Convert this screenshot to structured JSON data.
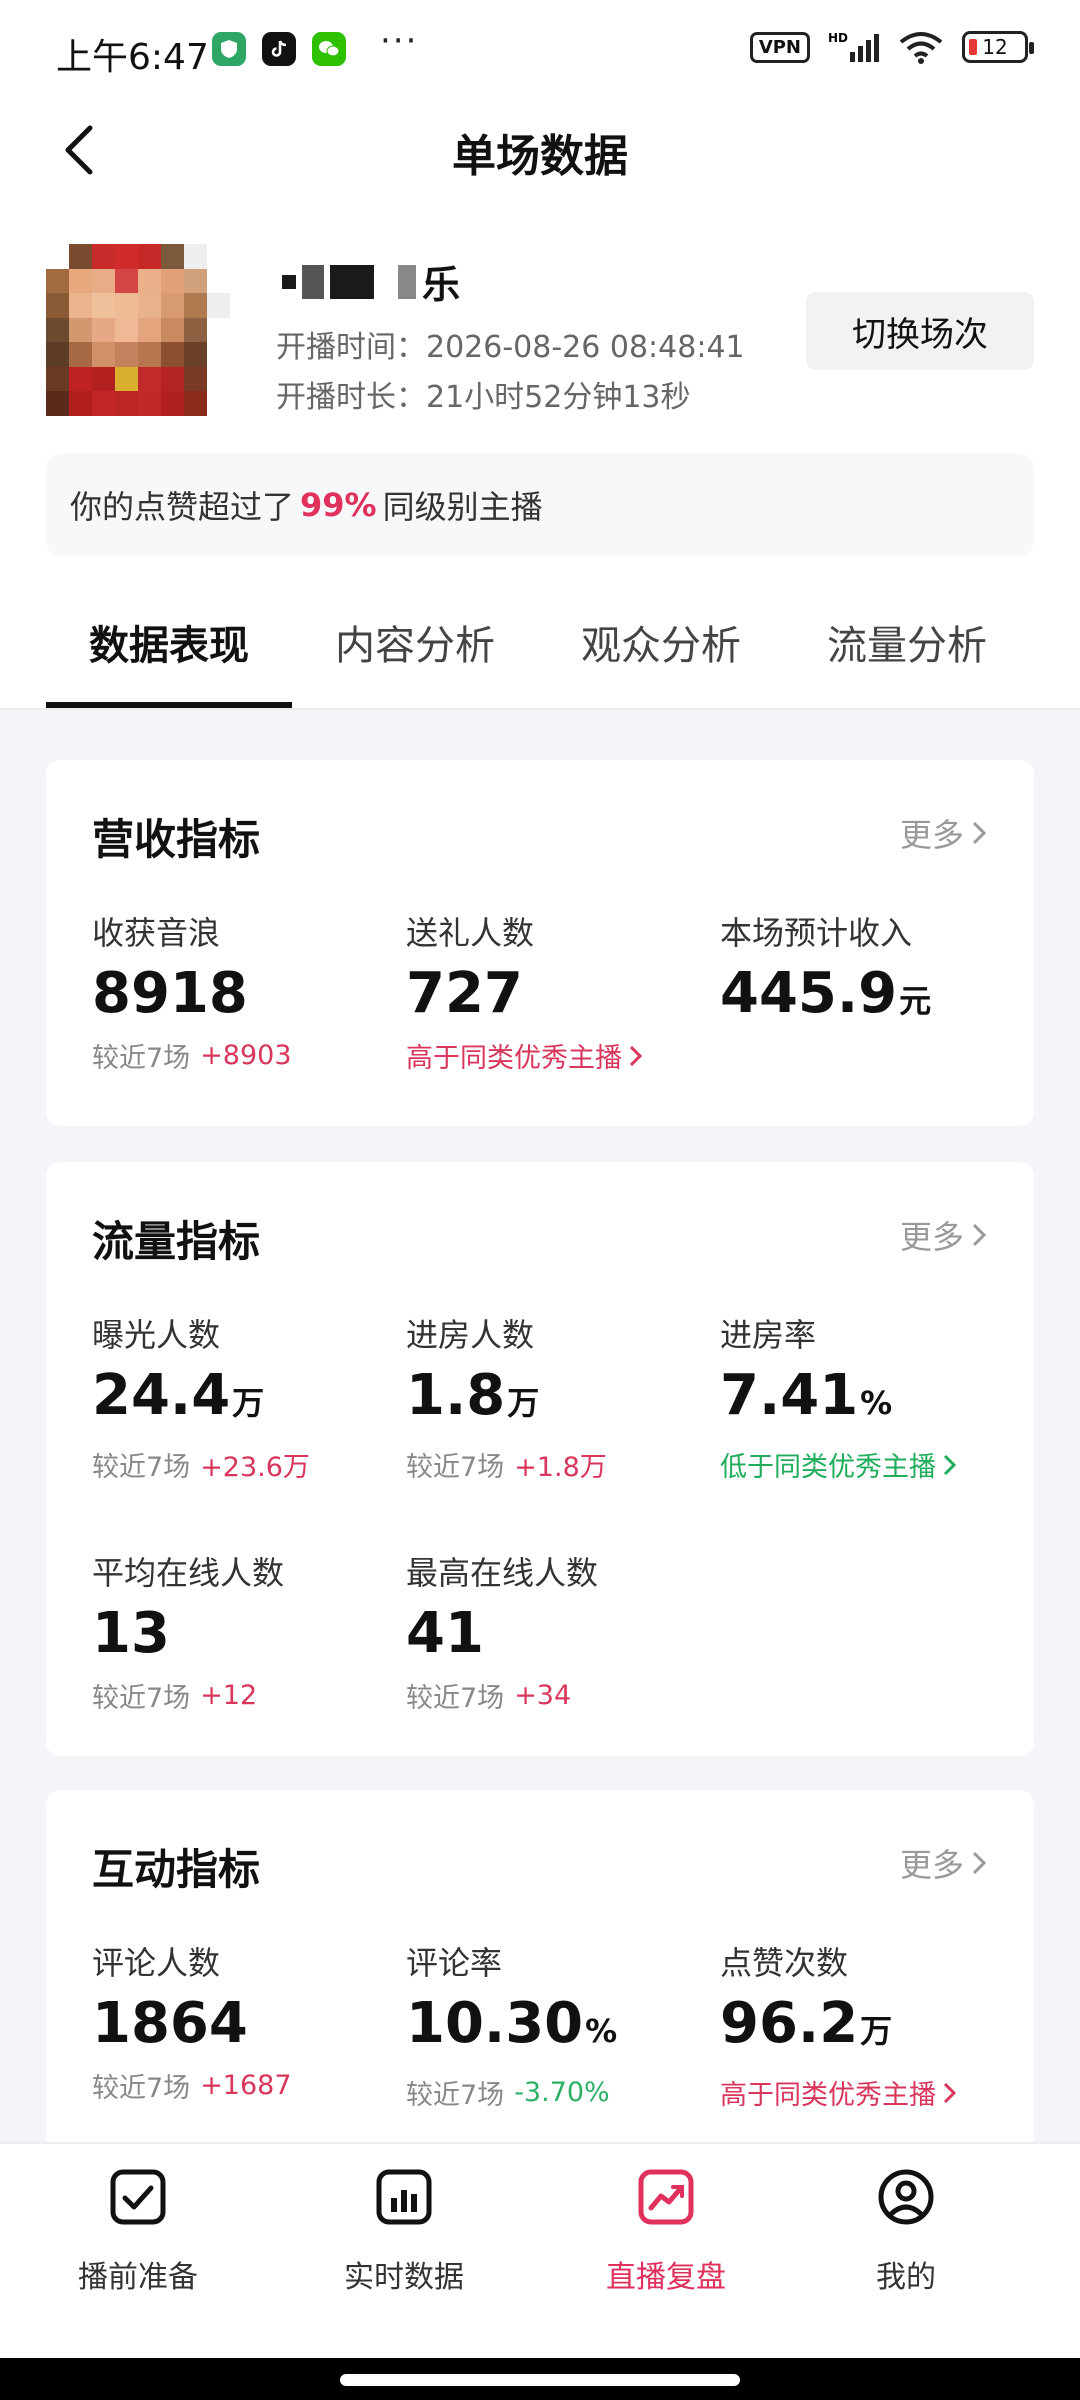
{
  "status_bar": {
    "time": "上午6:47",
    "vpn": "VPN",
    "battery": "12",
    "more_dots": "···"
  },
  "nav": {
    "title": "单场数据"
  },
  "profile": {
    "name_suffix": "乐",
    "start_time_label": "开播时间：",
    "start_time": "2026-08-26 08:48:41",
    "duration_label": "开播时长：",
    "duration": "21小时52分钟13秒",
    "switch_label": "切换场次"
  },
  "like_banner": {
    "prefix": "你的点赞超过了",
    "percent": "99%",
    "suffix": "同级别主播"
  },
  "tabs": [
    "数据表现",
    "内容分析",
    "观众分析",
    "流量分析"
  ],
  "revenue": {
    "title": "营收指标",
    "more": "更多",
    "metrics": [
      {
        "label": "收获音浪",
        "value": "8918",
        "unit": "",
        "sub_label": "较近7场",
        "delta": "+8903"
      },
      {
        "label": "送礼人数",
        "value": "727",
        "unit": "",
        "link": "高于同类优秀主播"
      },
      {
        "label": "本场预计收入",
        "value": "445.9",
        "unit": "元"
      }
    ]
  },
  "traffic": {
    "title": "流量指标",
    "more": "更多",
    "metrics": [
      {
        "label": "曝光人数",
        "value": "24.4",
        "unit": "万",
        "sub_label": "较近7场",
        "delta": "+23.6万"
      },
      {
        "label": "进房人数",
        "value": "1.8",
        "unit": "万",
        "sub_label": "较近7场",
        "delta": "+1.8万"
      },
      {
        "label": "进房率",
        "value": "7.41",
        "unit": "%",
        "link": "低于同类优秀主播"
      },
      {
        "label": "平均在线人数",
        "value": "13",
        "unit": "",
        "sub_label": "较近7场",
        "delta": "+12"
      },
      {
        "label": "最高在线人数",
        "value": "41",
        "unit": "",
        "sub_label": "较近7场",
        "delta": "+34"
      }
    ]
  },
  "interaction": {
    "title": "互动指标",
    "more": "更多",
    "metrics": [
      {
        "label": "评论人数",
        "value": "1864",
        "unit": "",
        "sub_label": "较近7场",
        "delta": "+1687"
      },
      {
        "label": "评论率",
        "value": "10.30",
        "unit": "%",
        "sub_label": "较近7场",
        "delta": "-3.70%"
      },
      {
        "label": "点赞次数",
        "value": "96.2",
        "unit": "万",
        "link": "高于同类优秀主播"
      }
    ]
  },
  "bottom_nav": [
    {
      "label": "播前准备",
      "icon": "checkbox-icon"
    },
    {
      "label": "实时数据",
      "icon": "bar-chart-icon"
    },
    {
      "label": "直播复盘",
      "icon": "trend-chart-icon"
    },
    {
      "label": "我的",
      "icon": "user-icon"
    }
  ],
  "colors": {
    "accent_red": "#e0305c",
    "up": "#d9365c",
    "down": "#2fb068"
  }
}
